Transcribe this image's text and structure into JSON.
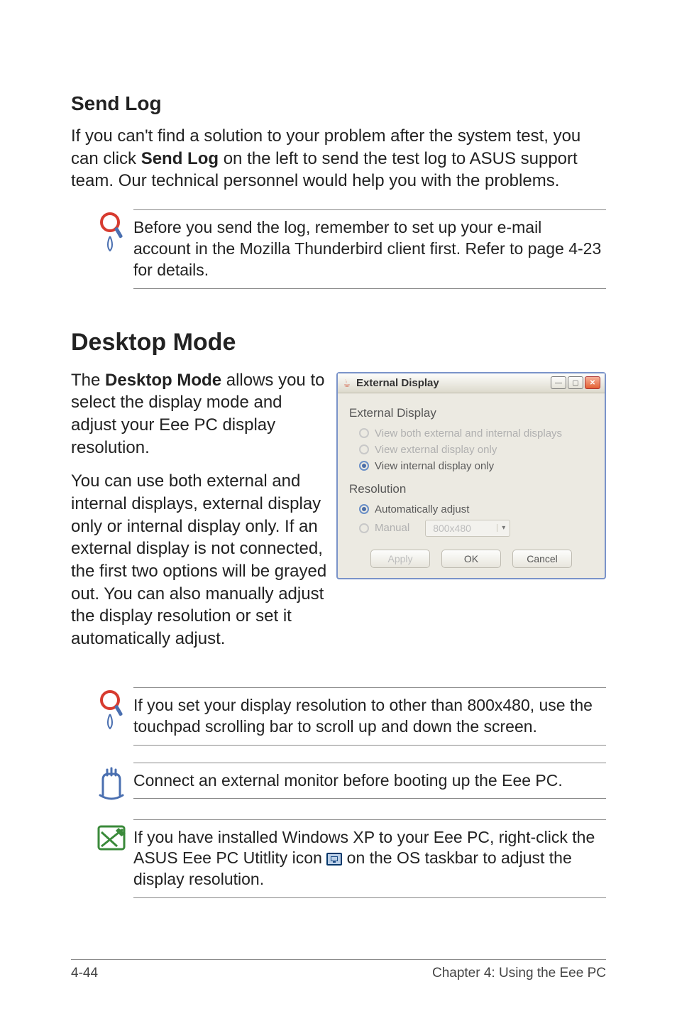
{
  "sendlog": {
    "heading": "Send Log",
    "paragraph_a": "If you can't find a solution to your problem after the system test, you can click ",
    "bold": "Send Log",
    "paragraph_b": " on the left to send the test log to ASUS support team. Our technical personnel would help you with the problems.",
    "note": "Before you send the log, remember to set up your e-mail account in the Mozilla Thunderbird client first. Refer to page 4-23 for details."
  },
  "desktop": {
    "heading": "Desktop Mode",
    "p1_a": "The ",
    "p1_bold": "Desktop Mode",
    "p1_b": " allows you to select the display mode and adjust your Eee PC display resolution.",
    "p2": "You can use both external and internal displays, external display only or internal display only. If an external display is not connected, the first two options will be grayed out. You can also manually adjust the display resolution or set it automatically adjust."
  },
  "dialog": {
    "title": "External Display",
    "group1": "External Display",
    "opt1": "View both external and internal displays",
    "opt2": "View external display only",
    "opt3": "View internal display only",
    "group2": "Resolution",
    "opt4": "Automatically adjust",
    "opt5": "Manual",
    "combo": "800x480",
    "apply": "Apply",
    "ok": "OK",
    "cancel": "Cancel"
  },
  "notes": {
    "tip2": "If you set your display resolution to other than 800x480, use the touchpad scrolling bar to scroll up and down the screen.",
    "important": "Connect an external monitor before booting up the Eee PC.",
    "note3_a": "If you have installed Windows XP to your Eee PC, right-click the ASUS Eee PC Utitlity icon ",
    "note3_b": " on the OS taskbar to adjust the display resolution."
  },
  "footer": {
    "page": "4-44",
    "chapter": "Chapter 4: Using the Eee PC"
  },
  "icons": {
    "tip": "tip-icon",
    "important": "important-icon",
    "note": "note-icon"
  }
}
